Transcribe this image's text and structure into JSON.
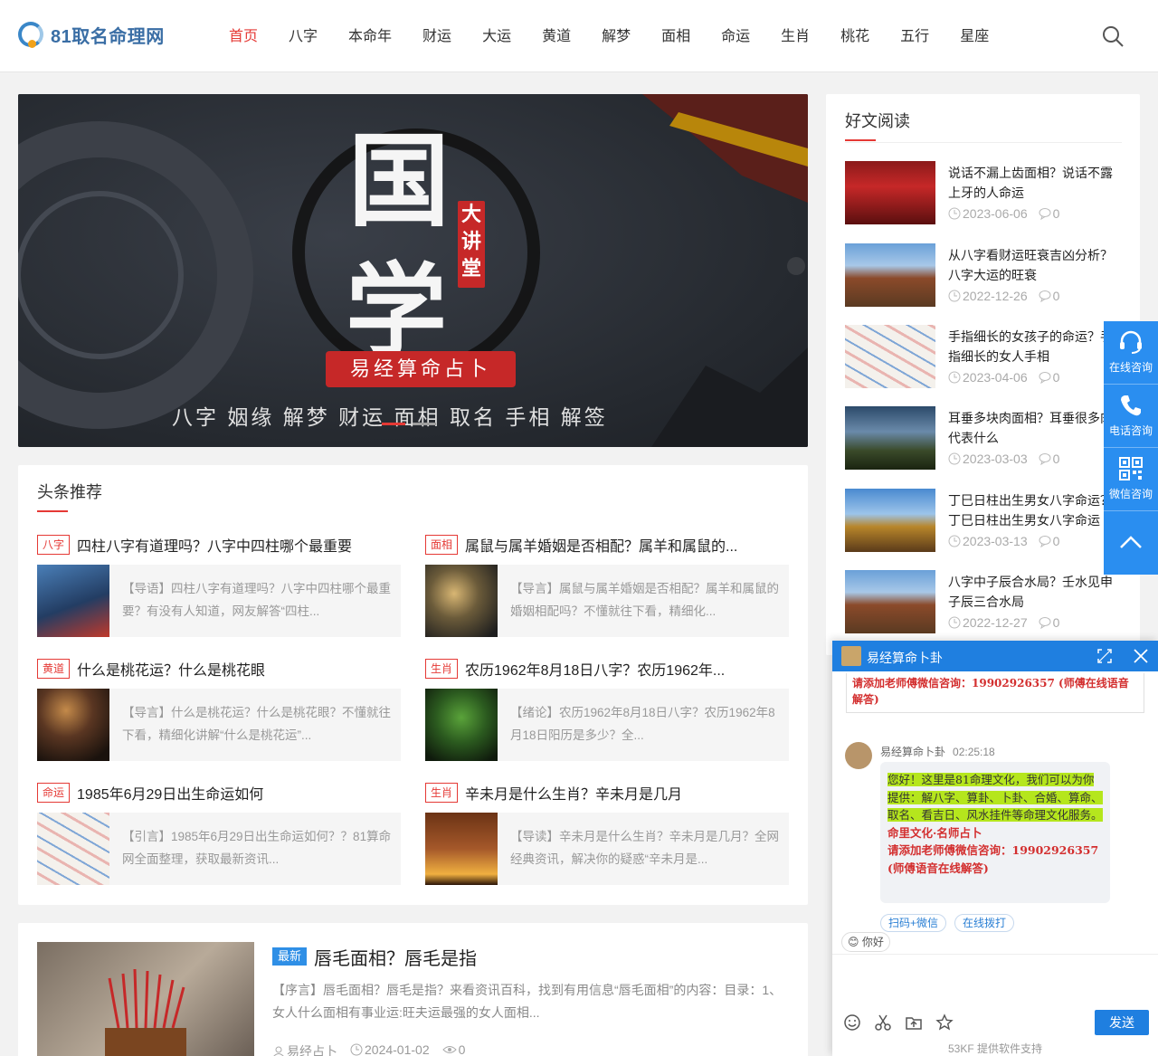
{
  "header": {
    "logo_text": "81取名命理网",
    "nav": [
      "首页",
      "八字",
      "本命年",
      "财运",
      "大运",
      "黄道",
      "解梦",
      "面相",
      "命运",
      "生肖",
      "桃花",
      "五行",
      "星座"
    ]
  },
  "banner": {
    "big_char_1": "国",
    "big_char_2": "学",
    "seal": "大讲堂",
    "subtitle": "易经算命占卜",
    "tags": "八字 姻缘 解梦 财运 面相 取名 手相 解签"
  },
  "headlines": {
    "title": "头条推荐",
    "items": [
      {
        "tag": "八字",
        "title": "四柱八字有道理吗？八字中四柱哪个最重要",
        "desc": "【导语】四柱八字有道理吗？八字中四柱哪个最重要？有没有人知道，网友解答“四柱..."
      },
      {
        "tag": "面相",
        "title": "属鼠与属羊婚姻是否相配？属羊和属鼠的...",
        "desc": "【导言】属鼠与属羊婚姻是否相配？属羊和属鼠的婚姻相配吗？不懂就往下看，精细化..."
      },
      {
        "tag": "黄道",
        "title": "什么是桃花运？什么是桃花眼",
        "desc": "【导言】什么是桃花运？什么是桃花眼？不懂就往下看，精细化讲解“什么是桃花运”..."
      },
      {
        "tag": "生肖",
        "title": "农历1962年8月18日八字？农历1962年...",
        "desc": "【绪论】农历1962年8月18日八字？农历1962年8月18日阳历是多少？全..."
      },
      {
        "tag": "命运",
        "title": "1985年6月29日出生命运如何",
        "desc": "【引言】1985年6月29日出生命运如何？？81算命网全面整理，获取最新资讯..."
      },
      {
        "tag": "生肖",
        "title": "辛未月是什么生肖？辛未月是几月",
        "desc": "【导读】辛未月是什么生肖？辛未月是几月？全网经典资讯，解决你的疑惑“辛未月是..."
      }
    ]
  },
  "article": {
    "tag": "最新",
    "title": "唇毛面相？唇毛是指",
    "desc": "【序言】唇毛面相？唇毛是指？来看资讯百科，找到有用信息“唇毛面相”的内容：目录：1、女人什么面相有事业运:旺夫运最强的女人面相...",
    "author": "易经占卜",
    "date": "2024-01-02",
    "views": "0"
  },
  "sidebar": {
    "title": "好文阅读",
    "items": [
      {
        "title": "说话不漏上齿面相？说话不露上牙的人命运",
        "date": "2023-06-06",
        "comments": "0"
      },
      {
        "title": "从八字看财运旺衰吉凶分析？八字大运的旺衰",
        "date": "2022-12-26",
        "comments": "0"
      },
      {
        "title": "手指细长的女孩子的命运？手指细长的女人手相",
        "date": "2023-04-06",
        "comments": "0"
      },
      {
        "title": "耳垂多块肉面相？耳垂很多肉代表什么",
        "date": "2023-03-03",
        "comments": "0"
      },
      {
        "title": "丁巳日柱出生男女八字命运？丁巳日柱出生男女八字命运",
        "date": "2023-03-13",
        "comments": "0"
      },
      {
        "title": "八字中子辰合水局？壬水见申子辰三合水局",
        "date": "2022-12-27",
        "comments": "0"
      }
    ]
  },
  "float_bar": {
    "online": "在线咨询",
    "phone": "电话咨询",
    "wechat": "微信咨询"
  },
  "chat": {
    "title": "易经算命卜卦",
    "notice": "请添加老师傅微信咨询：19902926357 (师傅在线语音解答)",
    "sender": "易经算命卜卦",
    "time": "02:25:18",
    "msg_highlight": "您好！这里是81命理文化，我们可以为你提供：解八字、算卦、卜卦、合婚、算命、取名、看吉日、风水挂件等命理文化服务。",
    "msg_brand": "命里文化·名师占卜",
    "msg_contact": "请添加老师傅微信咨询：19902926357 (师傅语音在线解答)",
    "quick_1": "扫码+微信",
    "quick_2": "在线拨打",
    "hello": "😊 你好",
    "send": "发送",
    "footer": "53KF 提供软件支持"
  }
}
